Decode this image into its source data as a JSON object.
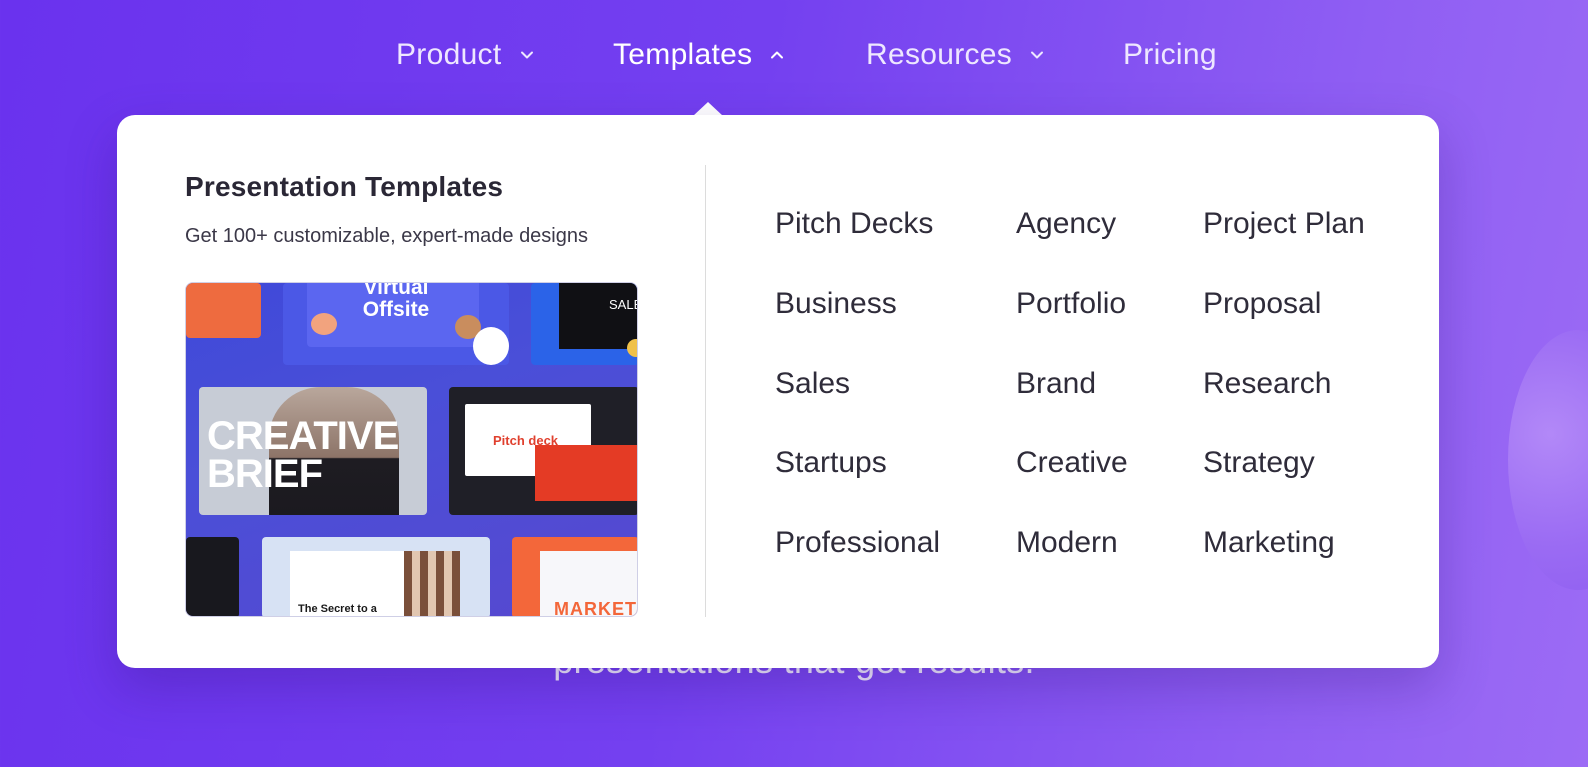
{
  "nav": {
    "items": [
      {
        "label": "Product",
        "chevron": "down"
      },
      {
        "label": "Templates",
        "chevron": "up"
      },
      {
        "label": "Resources",
        "chevron": "down"
      },
      {
        "label": "Pricing",
        "chevron": "none"
      }
    ]
  },
  "hero": {
    "subtitle_partial": "presentations that get results."
  },
  "dropdown": {
    "title": "Presentation Templates",
    "subtitle": "Get 100+ customizable, expert-made designs",
    "preview": {
      "thumb_texts": {
        "virtual": "Virtual",
        "offsite": "Offsite",
        "creative": "CREATIVE",
        "brief": "BRIEF",
        "pitch_deck": "Pitch deck",
        "secret": "The Secret to a",
        "market": "MARKET",
        "sale": "SALE"
      }
    },
    "links": [
      [
        "Pitch Decks",
        "Agency",
        "Project Plan"
      ],
      [
        "Business",
        "Portfolio",
        "Proposal"
      ],
      [
        "Sales",
        "Brand",
        "Research"
      ],
      [
        "Startups",
        "Creative",
        "Strategy"
      ],
      [
        "Professional",
        "Modern",
        "Marketing"
      ]
    ]
  },
  "colors": {
    "background_start": "#6a32ee",
    "background_end": "#9c6bf5",
    "panel": "#ffffff",
    "link_text": "#2f2c3a"
  }
}
